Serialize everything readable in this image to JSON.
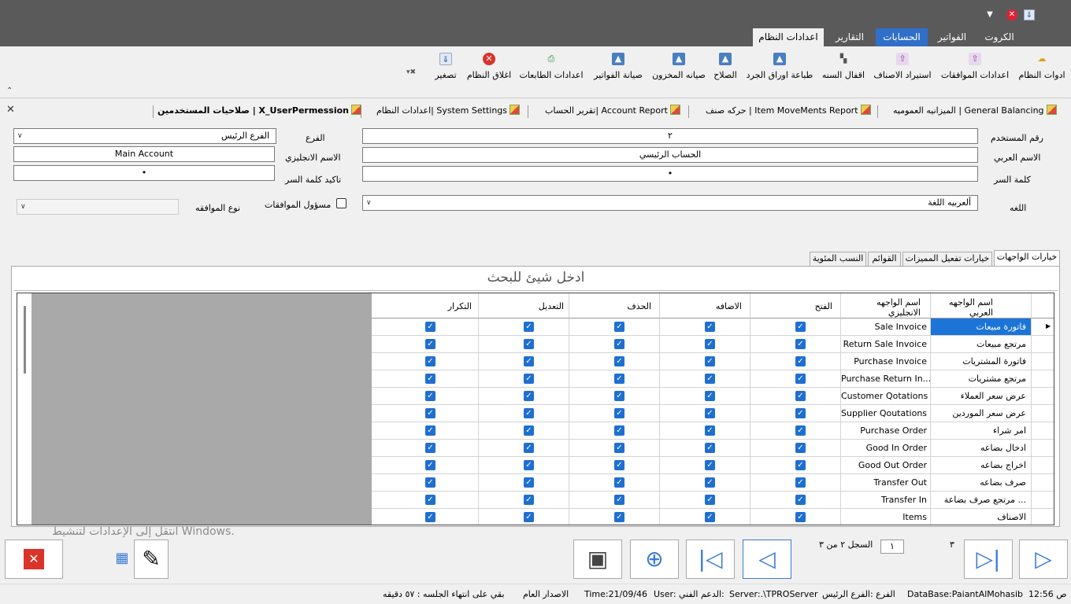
{
  "colors": {
    "accent": "#2f6fc8",
    "titlebar": "#5a5a5a",
    "selected_row": "#1c74d8",
    "checkbox": "#1f6fd1",
    "gray_area": "#a9a9a9"
  },
  "ribbon_tabs": [
    "الكروت",
    "الفواتير",
    "الحسابات",
    "التقارير",
    "اعدادات النظام"
  ],
  "ribbon_buttons": [
    {
      "label": "ادوات النظام",
      "icon": "tools-icon"
    },
    {
      "label": "اعدادات الموافقات",
      "icon": "approvals-icon"
    },
    {
      "label": "استيراد الاصناف",
      "icon": "import-icon"
    },
    {
      "label": "اقفال السنه",
      "icon": "year-close-icon"
    },
    {
      "label": "طباعة اوراق الجرد",
      "icon": "print-inventory-icon"
    },
    {
      "label": "الصلاح",
      "icon": "repair-icon"
    },
    {
      "label": "صيانه المخزون",
      "icon": "inventory-maintenance-icon"
    },
    {
      "label": "صيانة الفواتير",
      "icon": "invoice-maintenance-icon"
    },
    {
      "label": "اعدادات الطابعات",
      "icon": "printer-settings-icon"
    },
    {
      "label": "اغلاق النظام",
      "icon": "close-system-icon"
    },
    {
      "label": "تصغير",
      "icon": "minimize-icon"
    }
  ],
  "doc_tabs": [
    "الميزانيه العموميه | General Balancing",
    "حركه صنف | Item MoveMents Report",
    "تقرير الحساب| Account Report",
    "اعدادات النظام| System Settings",
    "صلاحيات المستخدمين | X_UserPermession"
  ],
  "form": {
    "user_no_label": "رقم المستخدم",
    "user_no": "٢",
    "arabic_name_label": "الاسم العربي",
    "arabic_name": "الحساب الرئيسي",
    "password_label": "كلمة السر",
    "password": "•",
    "language_label": "اللغه",
    "language": "ألعربيه اللغة",
    "branch_label": "الفرع",
    "branch": "الفرع الرئيس",
    "english_name_label": "الاسم الانجليزي",
    "english_name": "Main Account",
    "confirm_password_label": "تاكيد كلمة السر",
    "confirm_password": "•",
    "approvals_label": "مسؤول الموافقات",
    "approval_type_label": "نوع الموافقه"
  },
  "inner_tabs": [
    "خيارات الواجهات",
    "خيارات تفعيل المميزات",
    "القوائم",
    "النسب المئوية"
  ],
  "search_placeholder": "ادخل شيئ للبحث",
  "grid": {
    "headers": {
      "arabic_name": [
        "اسم الواجهه",
        "العربي"
      ],
      "english_name": [
        "اسم الواجهه",
        "الانجليزي"
      ],
      "open": "الفتح",
      "add": "الاضافه",
      "delete": "الحذف",
      "edit": "التعديل",
      "repeat": "التكرار"
    },
    "rows": [
      {
        "ar": "فاتورة مبيعات",
        "en": "Sale Invoice"
      },
      {
        "ar": "مرتجع مبيعات",
        "en": "Return Sale Invoice"
      },
      {
        "ar": "فاتورة المشتريات",
        "en": "Purchase Invoice"
      },
      {
        "ar": "مرتجع مشتريات",
        "en": "Purchase Return In..."
      },
      {
        "ar": "عرض سعر العملاء",
        "en": "Customer Qotations"
      },
      {
        "ar": "عرض سعر الموردين",
        "en": "Supplier Qoutations"
      },
      {
        "ar": "امر شراء",
        "en": "Purchase Order"
      },
      {
        "ar": "ادخال بضاعه",
        "en": "Good In Order"
      },
      {
        "ar": "اخراج بضاعه",
        "en": "Good Out Order"
      },
      {
        "ar": "صرف بضاعه",
        "en": "Transfer Out"
      },
      {
        "ar": "مرتجع صرف بضاعة ...",
        "en": "Transfer In"
      },
      {
        "ar": "الاصناف",
        "en": "Items"
      }
    ]
  },
  "watermark": "انتقل إلى الإعدادات لتنشيط Windows.",
  "nav": {
    "total": "٣",
    "current": "١",
    "record_text": "السجل ٢ من ٣"
  },
  "status": {
    "time": "ص 12:56",
    "database": "DataBase:PaiantAlMohasib",
    "branch": "الفرع :الفرع الرئيس",
    "server": "Server:.\\TPROServer",
    "support": "الدعم الفني:",
    "user": "User:",
    "date": "Time:21/09/46",
    "release": "الاصدار العام",
    "session": "بقي على انتهاء الجلسه : ٥٧ دقيقه"
  }
}
